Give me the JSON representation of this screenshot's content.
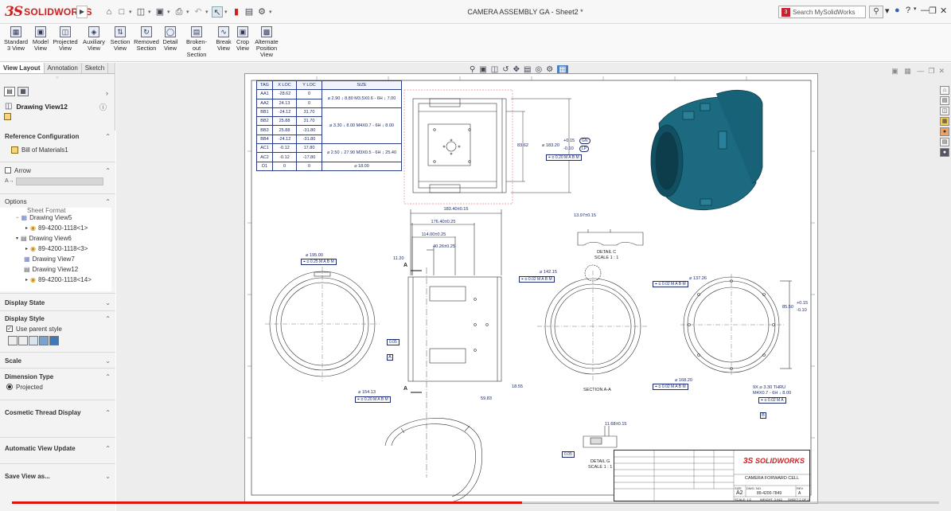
{
  "app": {
    "logo_mark": "3S",
    "logo_text": "SOLIDWORKS",
    "window_title": "CAMERA ASSEMBLY GA - Sheet2 *",
    "search_placeholder": "Search MySolidWorks",
    "help_icon": "?"
  },
  "colors": {
    "brand_red": "#d01f1f",
    "annotation_blue": "#1b2b70",
    "model_teal": "#1c6a80",
    "progress_red": "#e3120b"
  },
  "ribbon": {
    "items": [
      {
        "label": "Standard 3 View",
        "icon": "standard-3-view-icon"
      },
      {
        "label": "Model View",
        "icon": "model-view-icon"
      },
      {
        "label": "Projected View",
        "icon": "projected-view-icon"
      },
      {
        "label": "Auxiliary View",
        "icon": "auxiliary-view-icon"
      },
      {
        "label": "Section View",
        "icon": "section-view-icon"
      },
      {
        "label": "Removed Section",
        "icon": "removed-section-icon"
      },
      {
        "label": "Detail View",
        "icon": "detail-view-icon"
      },
      {
        "label": "Broken-out Section",
        "icon": "broken-out-section-icon"
      },
      {
        "label": "Break View",
        "icon": "break-view-icon"
      },
      {
        "label": "Crop View",
        "icon": "crop-view-icon"
      },
      {
        "label": "Alternate Position View",
        "icon": "alternate-position-view-icon"
      }
    ]
  },
  "leftpanel": {
    "tabs": [
      "View Layout",
      "Annotation",
      "Sketch"
    ],
    "property_title": "Drawing View12",
    "reference_configuration": {
      "header": "Reference Configuration",
      "value": "Bill of Materials1"
    },
    "arrow": {
      "header": "Arrow"
    },
    "options": {
      "header": "Options",
      "tree": [
        {
          "label": "Sheet Format"
        },
        {
          "label": "Drawing View5"
        },
        {
          "label": "89-4200-1118<1>"
        },
        {
          "label": "Drawing View6"
        },
        {
          "label": "89-4200-1118<3>"
        },
        {
          "label": "Drawing View7"
        },
        {
          "label": "Drawing View12"
        },
        {
          "label": "89-4200-1118<14>"
        }
      ]
    },
    "display_state": "Display State",
    "display_style": {
      "header": "Display Style",
      "checkbox": "Use parent style"
    },
    "scale": "Scale",
    "dimension_type": {
      "header": "Dimension Type",
      "option": "Projected"
    },
    "cosmetic_thread": "Cosmetic Thread Display",
    "auto_update": "Automatic View Update",
    "save_view": "Save View as..."
  },
  "hole_table": {
    "headers": [
      "TAG",
      "X LOC",
      "Y LOC",
      "SIZE"
    ],
    "rows": [
      [
        "AA1",
        "-28.62",
        "0",
        "⌀ 2.90 ↓ 8.80 M3.5X0.6 - 6H ↓ 7.00"
      ],
      [
        "AA2",
        "24.13",
        "0",
        ""
      ],
      [
        "BB1",
        "-24.12",
        "31.70",
        "⌀ 3.30 ↓ 8.00 M4X0.7 - 6H ↓ 8.00"
      ],
      [
        "BB2",
        "25.88",
        "31.70",
        ""
      ],
      [
        "BB3",
        "25.88",
        "-31.80",
        ""
      ],
      [
        "BB4",
        "-24.12",
        "-31.80",
        ""
      ],
      [
        "AC1",
        "-0.12",
        "17.80",
        "⌀ 2.50 ↓ 27.90 M3X0.5 - 6H ↓ 25.40"
      ],
      [
        "AC2",
        "-0.12",
        "-17.80",
        ""
      ],
      [
        "D1",
        "0",
        "0",
        "⌀ 18.00"
      ]
    ]
  },
  "dims": {
    "d1": "83.62",
    "d2": "⌀ 183.20",
    "d2_tol_up": "+0.15",
    "d2_tol_dn": "-0.10",
    "d2_gn": "GN",
    "d2_lp": "LP",
    "d2_fcf": "⌖ ⌀ 0.20 M  A B M",
    "d3": "183.40±0.15",
    "d4": "176.40±0.25",
    "d5": "114.00±0.25",
    "d6": "40.26±0.25",
    "d7": "11.20",
    "d8": "⌀ 195.00",
    "d8_fcf": "⌖ ⌀ 0.25 M  A B M",
    "d9": "⌀ 154.13",
    "d9_fcf": "⌖ ⌀ 0.20 M  A B M",
    "d10": "18.55",
    "d11": "59.83",
    "d12": "13.97±0.15",
    "d13": "⌀ 142.15",
    "d13_fcf": "⌖ ⌀ 0.02 M  A B M",
    "d14": "⌀ 137.26",
    "d14_fcf": "⌖ ⌀ 0.02 M  A B M",
    "d15": "85.50",
    "d15_tol_up": "+0.15",
    "d15_tol_dn": "-0.10",
    "d16": "⌀ 168.20",
    "d16_fcf": "⌖ ⌀ 0.02 M  A B M",
    "d17": "9X ⌀ 3.30 THRU",
    "d17b": "M4X0.7 - 6H ↓ 8.00",
    "d17_fcf": "⌖ ⌀ 0.02 M A",
    "d18": "11.68±0.15",
    "d19": "0.05",
    "d20": "0.05"
  },
  "labels": {
    "detail_c": "DETAIL C",
    "detail_c_scale": "SCALE 1 : 1",
    "section_aa": "SECTION A-A",
    "detail_g": "DETAIL G",
    "detail_g_scale": "SCALE 1 : 1",
    "datum_a": "A",
    "datum_b": "B",
    "arrow_a": "A"
  },
  "title_block": {
    "title": "CAMERA FORWARD CELL",
    "size": "A2",
    "dwg_no": "89-4200-7849",
    "rev": "A",
    "scale_text": "SCALE: 1:2",
    "weight_text": "WEIGHT: 3.942",
    "sheet_text": "SHEET 2 OF 2",
    "size_label": "SIZE",
    "dwg_label": "DWG. NO.",
    "rev_label": "REV"
  },
  "video": {
    "progress": 0.55
  }
}
